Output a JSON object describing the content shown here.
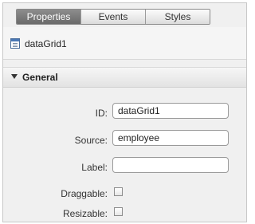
{
  "tabs": [
    {
      "label": "Properties",
      "active": true
    },
    {
      "label": "Events",
      "active": false
    },
    {
      "label": "Styles",
      "active": false
    }
  ],
  "component": {
    "name": "dataGrid1",
    "icon": "datagrid-icon"
  },
  "section": {
    "title": "General",
    "expanded": true
  },
  "fields": {
    "id": {
      "label": "ID:",
      "value": "dataGrid1"
    },
    "source": {
      "label": "Source:",
      "value": "employee"
    },
    "label": {
      "label": "Label:",
      "value": ""
    },
    "draggable": {
      "label": "Draggable:",
      "checked": false
    },
    "resizable": {
      "label": "Resizable:",
      "checked": false
    }
  },
  "colors": {
    "active_tab": "#7a7a7a",
    "panel_bg": "#f0f0f0"
  }
}
